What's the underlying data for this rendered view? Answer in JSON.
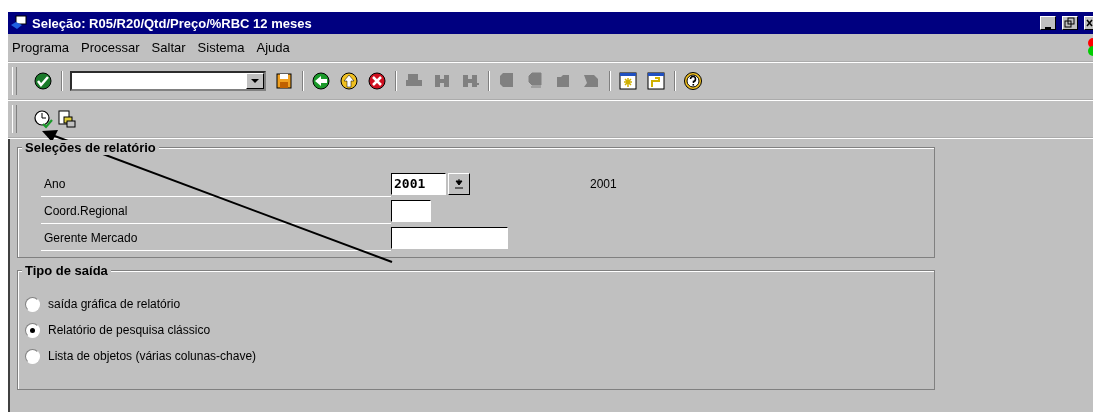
{
  "window": {
    "title": "Seleção: R05/R20/Qtd/Preço/%RBC 12 meses"
  },
  "menu": [
    "Programa",
    "Processar",
    "Saltar",
    "Sistema",
    "Ajuda"
  ],
  "toolbar": [
    [
      {
        "kind": "enter",
        "disabled": false
      }
    ],
    [
      {
        "kind": "command_field"
      },
      {
        "kind": "save",
        "disabled": false
      }
    ],
    [
      {
        "kind": "back",
        "disabled": false
      },
      {
        "kind": "exit",
        "disabled": false
      },
      {
        "kind": "cancel",
        "disabled": false
      }
    ],
    [
      {
        "kind": "print",
        "disabled": true
      },
      {
        "kind": "find",
        "disabled": true
      },
      {
        "kind": "find_next",
        "disabled": true
      }
    ],
    [
      {
        "kind": "first_page",
        "disabled": true
      },
      {
        "kind": "prev_page",
        "disabled": true
      },
      {
        "kind": "next_page",
        "disabled": true
      },
      {
        "kind": "last_page",
        "disabled": true
      }
    ],
    [
      {
        "kind": "new_session",
        "disabled": false
      },
      {
        "kind": "shortcut",
        "disabled": false
      }
    ],
    [
      {
        "kind": "help",
        "disabled": false
      }
    ]
  ],
  "app_toolbar": [
    {
      "kind": "execute"
    },
    {
      "kind": "get_variant"
    }
  ],
  "report_selections": {
    "title": "Seleções de relatório",
    "fields": [
      {
        "label": "Ano",
        "value": "2001",
        "kind": "dropdown",
        "description": "2001"
      },
      {
        "label": "Coord.Regional",
        "kind": "short"
      },
      {
        "label": "Gerente Mercado",
        "kind": "long"
      }
    ]
  },
  "output_type": {
    "title": "Tipo de saída",
    "options": [
      {
        "label": "saída gráfica de relatório",
        "selected": false
      },
      {
        "label": "Relatório de pesquisa clássico",
        "selected": true
      },
      {
        "label": "Lista de objetos (várias colunas-chave)",
        "selected": false
      }
    ]
  }
}
